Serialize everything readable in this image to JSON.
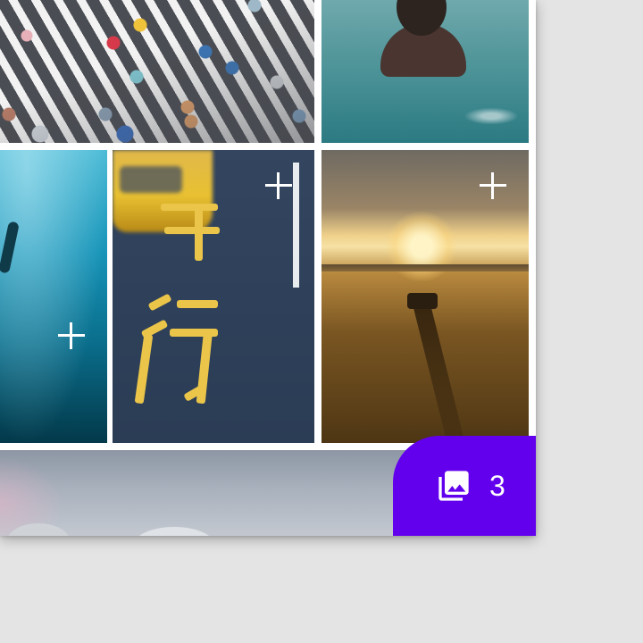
{
  "gallery": {
    "tiles": [
      {
        "name": "crosswalk-photo",
        "selectable": false
      },
      {
        "name": "swimmer-photo",
        "selectable": false
      },
      {
        "name": "underwater-photo",
        "selectable": true,
        "action_icon": "add-icon"
      },
      {
        "name": "taxi-road-photo",
        "selectable": true,
        "action_icon": "add-icon"
      },
      {
        "name": "beach-sunset-photo",
        "selectable": true,
        "action_icon": "add-icon"
      },
      {
        "name": "domes-photo",
        "selectable": false
      }
    ],
    "road_text": "行"
  },
  "selection_fab": {
    "icon": "photo-library-icon",
    "count": "3",
    "color": "#6200ee"
  },
  "colors": {
    "background": "#e4e4e4",
    "surface": "#ffffff",
    "accent": "#6200ee"
  }
}
